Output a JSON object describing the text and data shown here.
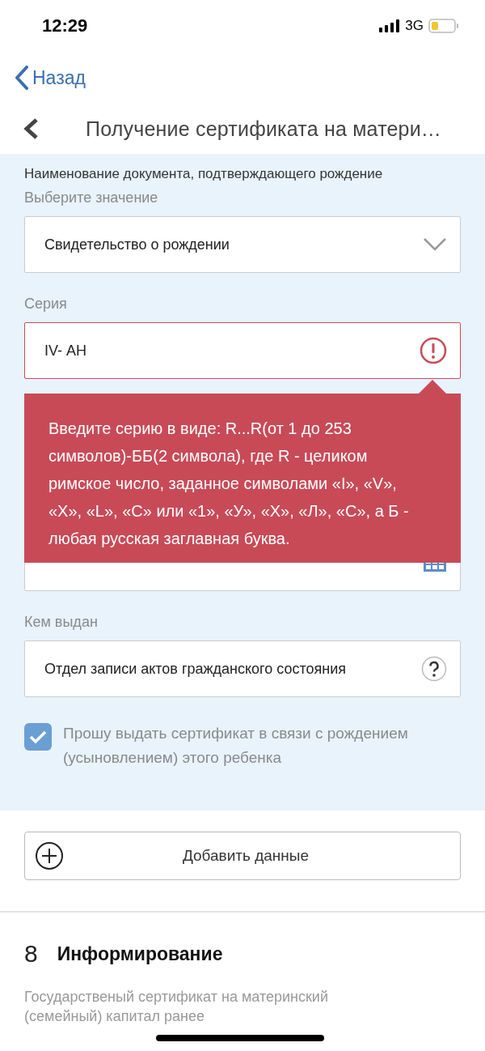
{
  "status_bar": {
    "time": "12:29",
    "network": "3G"
  },
  "nav": {
    "back_label": "Назад",
    "title": "Получение сертификата на матери…"
  },
  "form": {
    "document_label": "Наименование документа, подтверждающего рождение",
    "select_hint": "Выберите значение",
    "select_value": "Свидетельство о рождении",
    "series_label": "Серия",
    "series_value": "IV- АН",
    "series_error": true,
    "error_tooltip": "Введите серию в виде: R...R(от 1 до 253 символов)-ББ(2 символа), где R - целиком римское число, заданное символами «I», «V», «X», «L», «C» или «1», «У», «Х», «Л», «С», а Б - любая русская заглавная буква.",
    "issuer_label": "Кем выдан",
    "issuer_value": "Отдел записи актов гражданского состояния",
    "consent": {
      "label": "Прошу выдать сертификат в связи с рождением (усыновлением) этого ребенка",
      "checked": true
    }
  },
  "add_button": "Добавить данные",
  "section": {
    "number": "8",
    "title": "Информирование",
    "text": "Государственый сертификат на материнский (семейный) капитал ранее"
  }
}
